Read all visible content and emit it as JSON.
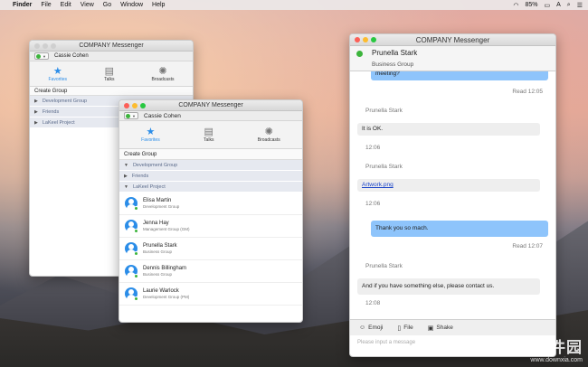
{
  "menubar": {
    "app": "Finder",
    "items": [
      "File",
      "Edit",
      "View",
      "Go",
      "Window",
      "Help"
    ],
    "battery": "85%",
    "input_source": "A"
  },
  "small_window": {
    "title": "COMPANY Messenger",
    "user": "Cassie Cohen",
    "tabs": [
      {
        "label": "Favorites",
        "icon": "star-icon"
      },
      {
        "label": "Talks",
        "icon": "chat-icon"
      },
      {
        "label": "Broadcasts",
        "icon": "megaphone-icon"
      }
    ],
    "create_group": "Create Group",
    "groups": [
      "Development Group",
      "Friends",
      "LaKeel Project"
    ]
  },
  "main_window": {
    "title": "COMPANY Messenger",
    "user": "Cassie Cohen",
    "tabs": [
      {
        "label": "Favorites",
        "icon": "star-icon"
      },
      {
        "label": "Talks",
        "icon": "chat-icon"
      },
      {
        "label": "Broadcasts",
        "icon": "megaphone-icon"
      }
    ],
    "create_group": "Create Group",
    "groups": [
      "Development Group",
      "Friends",
      "LaKeel Project"
    ],
    "contacts": [
      {
        "name": "Elisa Martin",
        "group": "Development Group"
      },
      {
        "name": "Jenna Hay",
        "group": "Management Group (GM)"
      },
      {
        "name": "Prunella Stark",
        "group": "Business Group"
      },
      {
        "name": "Dennis Billingham",
        "group": "Business Group"
      },
      {
        "name": "Laurie Warlock",
        "group": "Development Group (PM)"
      }
    ]
  },
  "chat_window": {
    "title": "COMPANY Messenger",
    "contact_name": "Prunella Stark",
    "contact_group": "Business Group",
    "messages": {
      "m0": "meeting?",
      "m0_meta": "Read 12:05",
      "sender1": "Prunella Stark",
      "m1": "It is OK.",
      "m1_time": "12:06",
      "sender2": "Prunella Stark",
      "m2": "Artwork.png",
      "m2_time": "12:06",
      "m3": "Thank you so mach.",
      "m3_meta": "Read 12:07",
      "sender3": "Prunella Stark",
      "m4": "And if you have something else, please contact us.",
      "m4_time": "12:08"
    },
    "toolbar": {
      "emoji": "Emoji",
      "file": "File",
      "shake": "Shake"
    },
    "input_placeholder": "Please input a message"
  },
  "watermark": {
    "line1": "当下软件园",
    "line2": "www.downxia.com"
  }
}
